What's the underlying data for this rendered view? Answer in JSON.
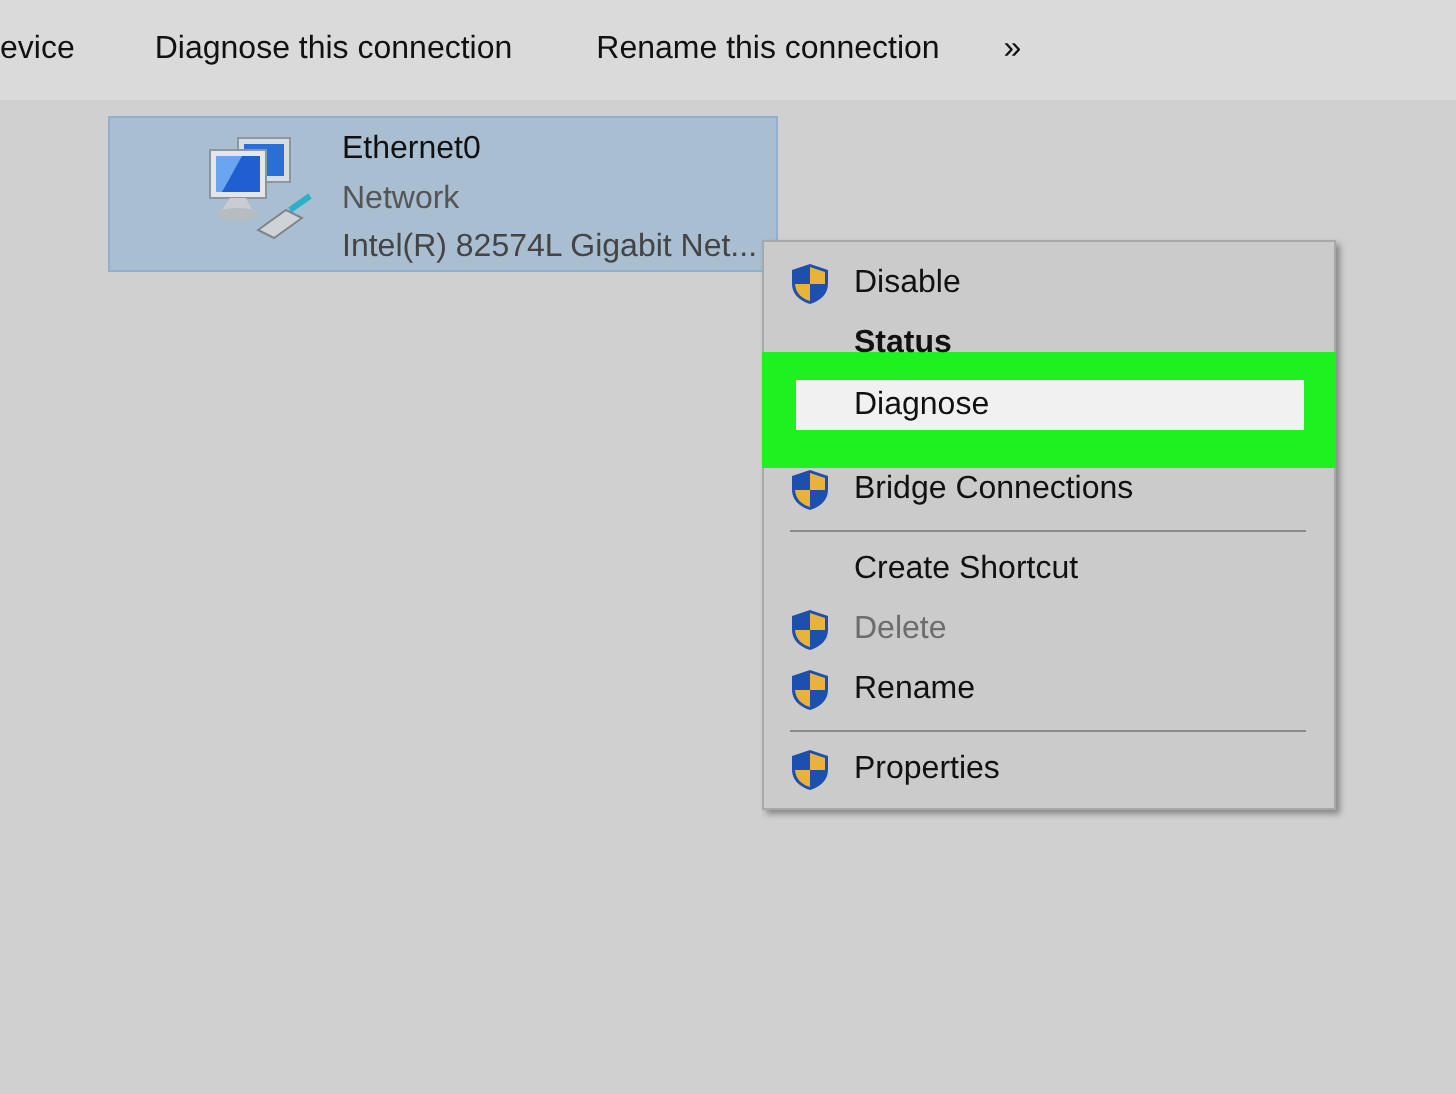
{
  "toolbar": [
    {
      "label": "evice"
    },
    {
      "label": "Diagnose this connection"
    },
    {
      "label": "Rename this connection"
    },
    {
      "label": "»"
    }
  ],
  "connection": {
    "name": "Ethernet0",
    "network": "Network",
    "adapter": "Intel(R) 82574L Gigabit Net...",
    "selected": true
  },
  "context_menu": [
    {
      "kind": "item",
      "label": "Disable",
      "shield": true,
      "disabled": false,
      "default": false,
      "selected": false,
      "highlighted": false
    },
    {
      "kind": "item",
      "label": "Status",
      "shield": false,
      "disabled": false,
      "default": true,
      "selected": false,
      "highlighted": false
    },
    {
      "kind": "item",
      "label": "Diagnose",
      "shield": false,
      "disabled": false,
      "default": false,
      "selected": true,
      "highlighted": true
    },
    {
      "kind": "item",
      "label": "Bridge Connections",
      "shield": true,
      "disabled": false,
      "default": false,
      "selected": false,
      "highlighted": false
    },
    {
      "kind": "separator"
    },
    {
      "kind": "item",
      "label": "Create Shortcut",
      "shield": false,
      "disabled": false,
      "default": false,
      "selected": false,
      "highlighted": false
    },
    {
      "kind": "item",
      "label": "Delete",
      "shield": true,
      "disabled": true,
      "default": false,
      "selected": false,
      "highlighted": false
    },
    {
      "kind": "item",
      "label": "Rename",
      "shield": true,
      "disabled": false,
      "default": false,
      "selected": false,
      "highlighted": false
    },
    {
      "kind": "separator"
    },
    {
      "kind": "item",
      "label": "Properties",
      "shield": true,
      "disabled": false,
      "default": false,
      "selected": false,
      "highlighted": false
    }
  ]
}
